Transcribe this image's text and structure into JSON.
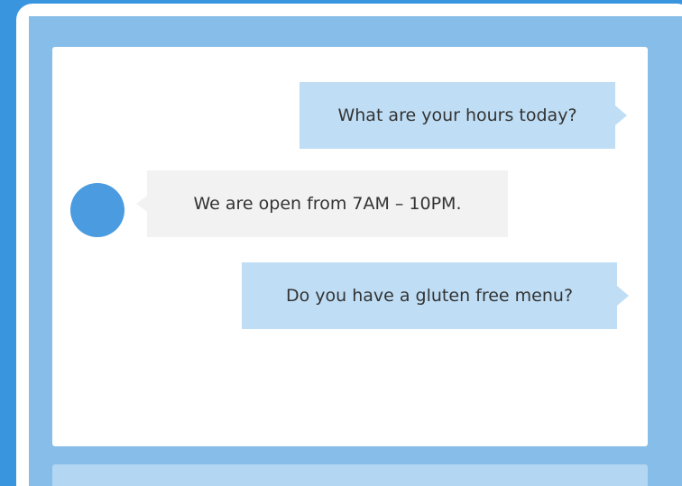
{
  "colors": {
    "background": "#3a95df",
    "panel": "#86bde9",
    "user_bubble": "#bfdef5",
    "bot_bubble": "#f2f2f2",
    "avatar": "#4a9be0"
  },
  "chat": {
    "messages": [
      {
        "sender": "user",
        "text": "What are your hours today?"
      },
      {
        "sender": "bot",
        "text": "We are open from 7AM – 10PM."
      },
      {
        "sender": "user",
        "text": "Do you have a gluten free menu?"
      }
    ],
    "bot_avatar_icon": "avatar-circle-icon"
  }
}
